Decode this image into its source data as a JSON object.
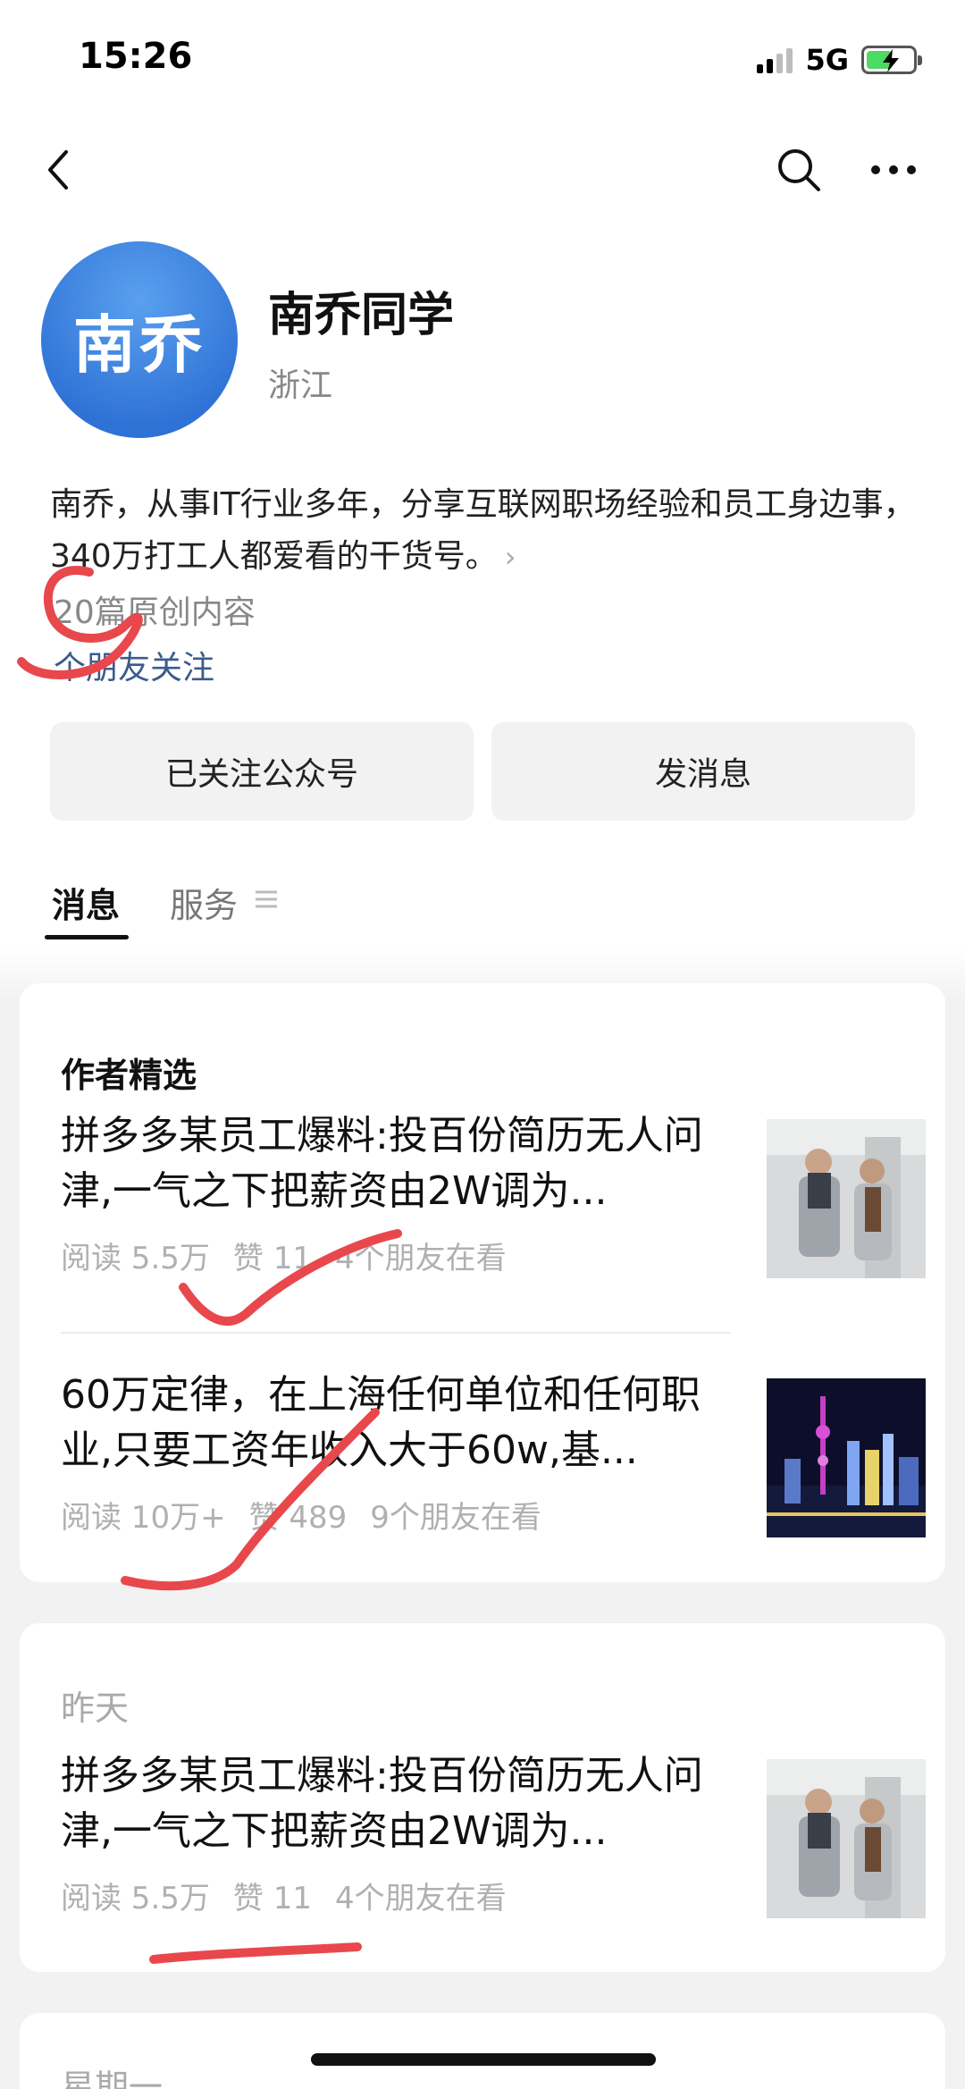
{
  "status_bar": {
    "time": "15:26",
    "network": "5G"
  },
  "nav": {
    "back_icon": "chevron-left-icon",
    "search_icon": "search-icon",
    "more_icon": "more-horizontal-icon"
  },
  "profile": {
    "avatar_text": "南乔",
    "name": "南乔同学",
    "region": "浙江",
    "bio": "南乔，从事IT行业多年，分享互联网职场经验和员工身边事，340万打工人都爱看的干货号。",
    "original_count": "20篇原创内容",
    "friends_following": "个朋友关注"
  },
  "actions": {
    "follow_label": "已关注公众号",
    "message_label": "发消息"
  },
  "tabs": {
    "messages": "消息",
    "services": "服务"
  },
  "featured": {
    "heading": "作者精选",
    "articles": [
      {
        "title": "拼多多某员工爆料:投百份简历无人问津,一气之下把薪资由2W调为...",
        "reads": "阅读 5.5万",
        "likes": "赞 11",
        "friends": "4个朋友在看"
      },
      {
        "title": "60万定律，在上海任何单位和任何职业,只要工资年收入大于60w,基...",
        "reads": "阅读 10万+",
        "likes": "赞 489",
        "friends": "9个朋友在看"
      }
    ]
  },
  "yesterday": {
    "heading": "昨天",
    "articles": [
      {
        "title": "拼多多某员工爆料:投百份简历无人问津,一气之下把薪资由2W调为...",
        "reads": "阅读 5.5万",
        "likes": "赞 11",
        "friends": "4个朋友在看"
      }
    ]
  },
  "monday": {
    "heading": "星期一"
  },
  "colors": {
    "accent_link": "#3b5b8c",
    "avatar_blue": "#2f72d6",
    "annotation_red": "#e8484c"
  }
}
